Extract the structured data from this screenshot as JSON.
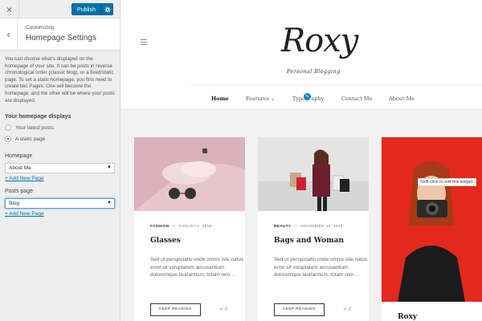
{
  "customizer": {
    "close_label": "×",
    "publish_label": "Publish",
    "gear_icon": "gear-icon",
    "back_label": "‹",
    "breadcrumb": "Customizing",
    "section_title": "Homepage Settings",
    "description": "You can choose what's displayed on the homepage of your site. It can be posts in reverse chronological order (classic blog), or a fixed/static page. To set a static homepage, you first need to create two Pages. One will become the homepage, and the other will be where your posts are displayed.",
    "homepage_displays_title": "Your homepage displays",
    "radio_options": [
      {
        "label": "Your latest posts",
        "checked": false
      },
      {
        "label": "A static page",
        "checked": true
      }
    ],
    "homepage_label": "Homepage",
    "homepage_value": "About Me",
    "posts_page_label": "Posts page",
    "posts_page_value": "Blog",
    "add_new_page": "+ Add New Page",
    "accent": "#0073aa"
  },
  "site": {
    "logo": "Roxy",
    "tagline": "Personal Blogging",
    "nav": [
      {
        "label": "Home",
        "active": true
      },
      {
        "label": "Features ⌄",
        "active": false
      },
      {
        "label": "Typography",
        "active": false
      },
      {
        "label": "Contact Me",
        "active": false
      },
      {
        "label": "About Me",
        "active": false
      }
    ],
    "posts": [
      {
        "category": "FASHION",
        "date": "AUGUST 1, 2016",
        "title": "Glasses",
        "excerpt": "Sed ut perspiciatis unde omnis iste natus error sit voluptatem accusantium doloremque laudantium, totam rem ...",
        "button": "KEEP READING",
        "shares": "0"
      },
      {
        "category": "BEAUTY",
        "date": "NOVEMBER 14, 2015",
        "title": "Bags and Woman",
        "excerpt": "Sed ut perspiciatis unde omnis iste natus error sit voluptatem accusantium doloremque laudantium, totam rem ...",
        "button": "KEEP READING",
        "shares": "0"
      },
      {
        "title": "Roxy"
      }
    ],
    "tooltip": "Shift-click to edit this widget."
  }
}
